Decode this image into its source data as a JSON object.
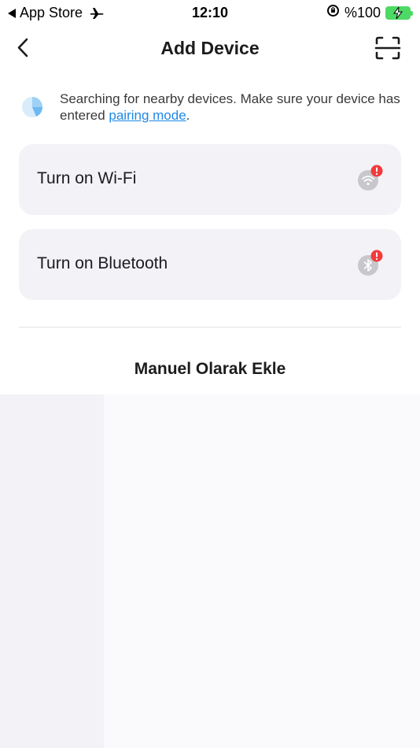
{
  "status_bar": {
    "back_app": "App Store",
    "time": "12:10",
    "battery": "%100"
  },
  "header": {
    "title": "Add Device"
  },
  "search": {
    "text": "Searching for nearby devices. Make sure your device has entered ",
    "link": "pairing mode",
    "suffix": "."
  },
  "prompts": [
    {
      "label": "Turn on Wi-Fi",
      "icon": "wifi-off-icon"
    },
    {
      "label": "Turn on Bluetooth",
      "icon": "bluetooth-off-icon"
    }
  ],
  "manual": {
    "title": "Manuel Olarak Ekle"
  },
  "colors": {
    "accent_link": "#1e88e5",
    "alert_red": "#f23b3b",
    "card_bg": "#f2f2f7",
    "battery_green": "#4cd964"
  }
}
